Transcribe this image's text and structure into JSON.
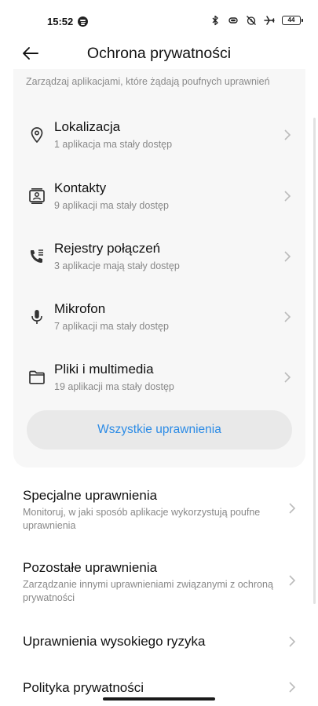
{
  "status": {
    "time": "15:52",
    "battery": "44"
  },
  "header": {
    "title": "Ochrona prywatności"
  },
  "card": {
    "subtitle": "Zarządzaj aplikacjami, które żądają poufnych uprawnień",
    "items": [
      {
        "title": "Lokalizacja",
        "subtitle": "1 aplikacja ma stały dostęp",
        "icon": "location-icon"
      },
      {
        "title": "Kontakty",
        "subtitle": "9 aplikacji ma stały dostęp",
        "icon": "contacts-icon"
      },
      {
        "title": "Rejestry połączeń",
        "subtitle": "3 aplikacje mają stały dostęp",
        "icon": "call-log-icon"
      },
      {
        "title": "Mikrofon",
        "subtitle": "7 aplikacji ma stały dostęp",
        "icon": "microphone-icon"
      },
      {
        "title": "Pliki i multimedia",
        "subtitle": "19 aplikacji ma stały dostęp",
        "icon": "folder-icon"
      }
    ],
    "all_button": "Wszystkie uprawnienia"
  },
  "list": [
    {
      "title": "Specjalne uprawnienia",
      "desc": "Monitoruj, w jaki sposób aplikacje wykorzystują poufne uprawnienia"
    },
    {
      "title": "Pozostałe uprawnienia",
      "desc": "Zarządzanie innymi uprawnieniami związanymi z ochroną prywatności"
    },
    {
      "title": "Uprawnienia wysokiego ryzyka",
      "desc": ""
    },
    {
      "title": "Polityka prywatności",
      "desc": ""
    }
  ],
  "colors": {
    "accent": "#2b8be6",
    "card_bg": "#f7f7f7",
    "button_bg": "#e9e9e9"
  }
}
